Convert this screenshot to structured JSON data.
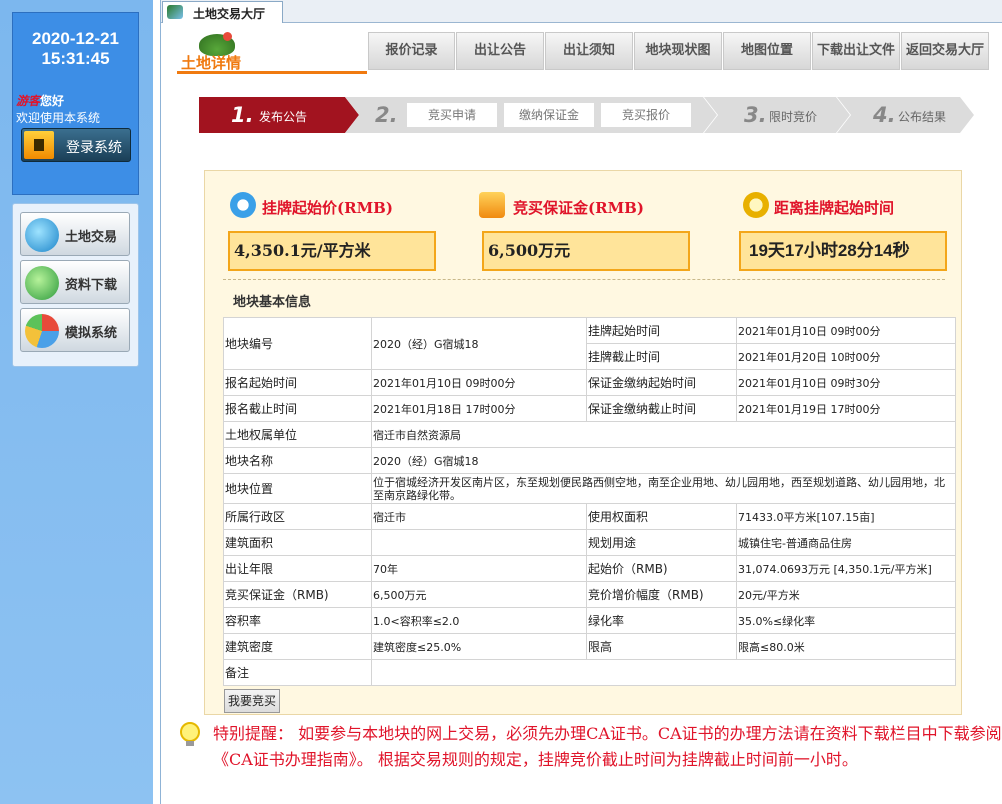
{
  "sidebar": {
    "date": "2020-12-21",
    "time": "15:31:45",
    "greeting_name": "游客",
    "greeting_suffix": "您好",
    "welcome": "欢迎使用本系统",
    "login_label": "登录系统",
    "nav": [
      {
        "label": "土地交易",
        "icon": "globe-monitor-icon"
      },
      {
        "label": "资料下载",
        "icon": "download-globe-icon"
      },
      {
        "label": "模拟系统",
        "icon": "pie-chart-icon"
      }
    ]
  },
  "tab": {
    "label": "土地交易大厅",
    "icon": "app-icon"
  },
  "header": {
    "logo_text": "土地详情",
    "buttons": [
      "报价记录",
      "出让公告",
      "出让须知",
      "地块现状图",
      "地图位置",
      "下载出让文件",
      "返回交易大厅"
    ]
  },
  "steps": {
    "items": [
      {
        "num": "1.",
        "label": "发布公告",
        "active": true
      },
      {
        "num": "2.",
        "label": "",
        "active": false
      },
      {
        "num": "3.",
        "label": "限时竞价",
        "active": false
      },
      {
        "num": "4.",
        "label": "公布结果",
        "active": false
      }
    ],
    "substeps": [
      "竞买申请",
      "缴纳保证金",
      "竞买报价"
    ]
  },
  "stats": {
    "start_price_title": "挂牌起始价(RMB)",
    "start_price_value": "4,350.1元/平方米",
    "deposit_title": "竞买保证金(RMB)",
    "deposit_value": "6,500万元",
    "countdown_title": "距离挂牌起始时间",
    "countdown_value": "19天17小时28分14秒"
  },
  "section_title": "地块基本信息",
  "table": {
    "parcel_no_label": "地块编号",
    "parcel_no": "2020（经）G宿城18",
    "list_start_label": "挂牌起始时间",
    "list_start": "2021年01月10日 09时00分",
    "list_end_label": "挂牌截止时间",
    "list_end": "2021年01月20日 10时00分",
    "reg_start_label": "报名起始时间",
    "reg_start": "2021年01月10日 09时00分",
    "dep_start_label": "保证金缴纳起始时间",
    "dep_start": "2021年01月10日 09时30分",
    "reg_end_label": "报名截止时间",
    "reg_end": "2021年01月18日 17时00分",
    "dep_end_label": "保证金缴纳截止时间",
    "dep_end": "2021年01月19日 17时00分",
    "owner_label": "土地权属单位",
    "owner": "宿迁市自然资源局",
    "name_label": "地块名称",
    "name": "2020（经）G宿城18",
    "location_label": "地块位置",
    "location": "位于宿城经济开发区南片区，东至规划便民路西侧空地，南至企业用地、幼儿园用地，西至规划道路、幼儿园用地，北至南京路绿化带。",
    "district_label": "所属行政区",
    "district": "宿迁市",
    "use_area_label": "使用权面积",
    "use_area": "71433.0平方米[107.15亩]",
    "build_area_label": "建筑面积",
    "build_area": "",
    "plan_use_label": "规划用途",
    "plan_use": "城镇住宅-普通商品住房",
    "years_label": "出让年限",
    "years": "70年",
    "start_price_label": "起始价（RMB)",
    "start_price": "31,074.0693万元 [4,350.1元/平方米]",
    "deposit_label": "竞买保证金（RMB)",
    "deposit": "6,500万元",
    "increment_label": "竞价增价幅度（RMB)",
    "increment": "20元/平方米",
    "far_label": "容积率",
    "far": "1.0<容积率≤2.0",
    "green_label": "绿化率",
    "green": "35.0%≤绿化率",
    "density_label": "建筑密度",
    "density": "建筑密度≤25.0%",
    "height_label": "限高",
    "height": "限高≤80.0米",
    "remark_label": "备注",
    "remark": ""
  },
  "bid_button": "我要竞买",
  "notice": "特别提醒：  如要参与本地块的网上交易，必须先办理CA证书。CA证书的办理方法请在资料下载栏目中下载参阅《CA证书办理指南》。  根据交易规则的规定，挂牌竞价截止时间为挂牌截止时间前一小时。",
  "colors": {
    "sidebar_bg": "#8dc2f2",
    "active_step": "#a2131f",
    "inactive_step": "#dcdcdc",
    "accent_orange": "#f07a10",
    "panel_bg": "#fff8e1",
    "stat_box": "#ffe49a",
    "alert_red": "#e0142a"
  }
}
